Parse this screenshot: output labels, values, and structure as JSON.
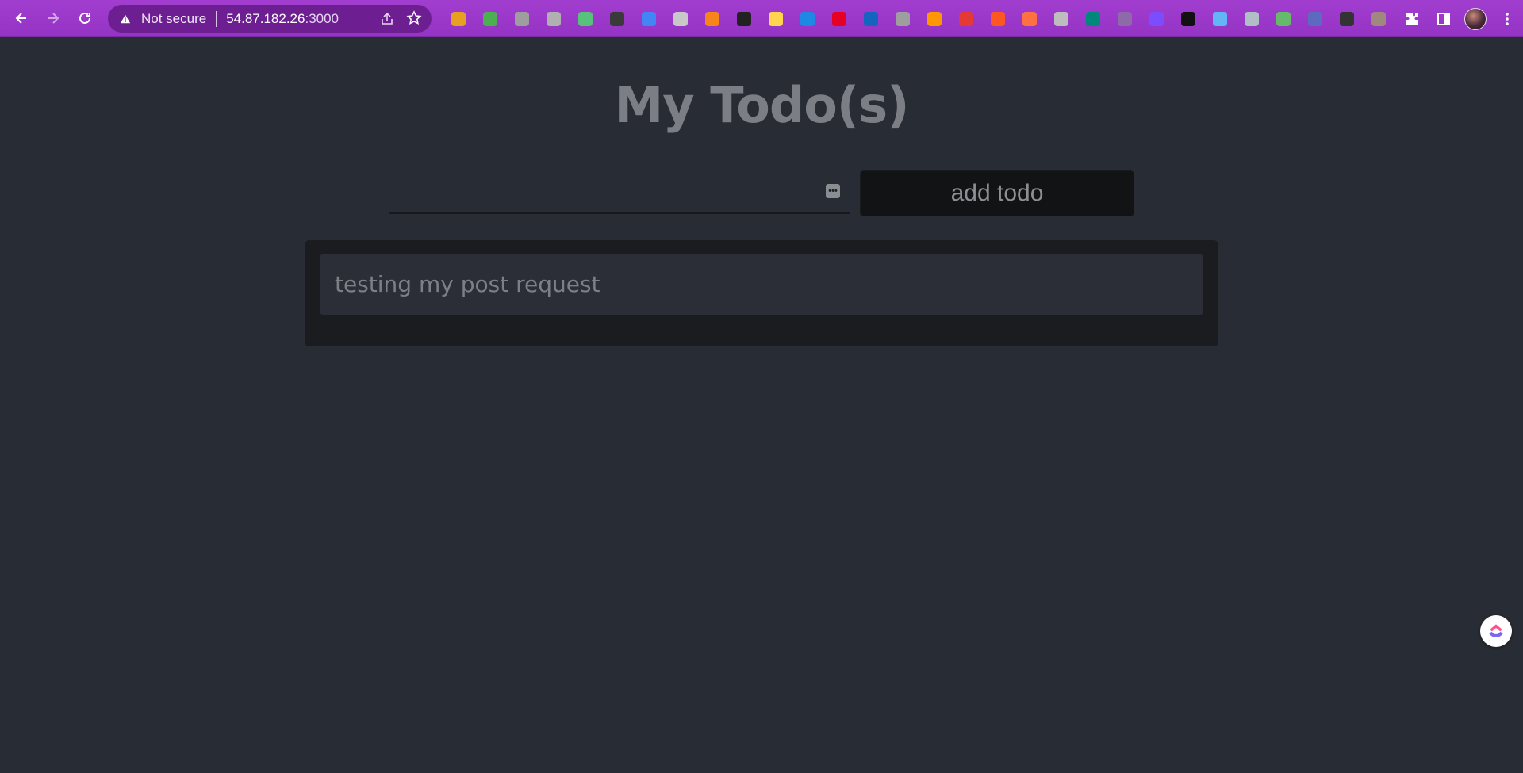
{
  "browser": {
    "security_label": "Not secure",
    "url_host": "54.87.182.26",
    "url_port": ":3000",
    "extensions": [
      {
        "name": "ext-1",
        "color": "#e8a020"
      },
      {
        "name": "ext-2",
        "color": "#4caf50"
      },
      {
        "name": "ext-3",
        "color": "#9e9e9e"
      },
      {
        "name": "ext-4",
        "color": "#b0b0b0"
      },
      {
        "name": "ext-5",
        "color": "#58c27d"
      },
      {
        "name": "ext-6",
        "color": "#3a3a3a"
      },
      {
        "name": "ext-7",
        "color": "#4285f4"
      },
      {
        "name": "ext-8",
        "color": "#c8c8c8"
      },
      {
        "name": "ext-9",
        "color": "#f6851b"
      },
      {
        "name": "ext-10",
        "color": "#222222"
      },
      {
        "name": "ext-11",
        "color": "#ffd54f"
      },
      {
        "name": "ext-12",
        "color": "#1e88e5"
      },
      {
        "name": "ext-13",
        "color": "#e60023"
      },
      {
        "name": "ext-14",
        "color": "#1565c0"
      },
      {
        "name": "ext-15",
        "color": "#9e9e9e"
      },
      {
        "name": "ext-16",
        "color": "#ff9800"
      },
      {
        "name": "ext-17",
        "color": "#e53935"
      },
      {
        "name": "ext-18",
        "color": "#ff5722"
      },
      {
        "name": "ext-19",
        "color": "#ff7043"
      },
      {
        "name": "ext-20",
        "color": "#bdbdbd"
      },
      {
        "name": "ext-21",
        "color": "#00897b"
      },
      {
        "name": "ext-22",
        "color": "#8e6aa8"
      },
      {
        "name": "ext-23",
        "color": "#7c4dff"
      },
      {
        "name": "ext-24",
        "color": "#111111"
      },
      {
        "name": "ext-25",
        "color": "#64b5f6"
      },
      {
        "name": "ext-26",
        "color": "#b0bec5"
      },
      {
        "name": "ext-27",
        "color": "#66bb6a"
      },
      {
        "name": "ext-28",
        "color": "#5c6bc0"
      },
      {
        "name": "ext-29",
        "color": "#333333"
      },
      {
        "name": "ext-30",
        "color": "#a1887f"
      }
    ]
  },
  "app": {
    "title": "My Todo(s)",
    "input": {
      "value": "",
      "placeholder": ""
    },
    "add_button_label": "add todo",
    "todos": [
      {
        "text": "testing my post request"
      }
    ]
  }
}
